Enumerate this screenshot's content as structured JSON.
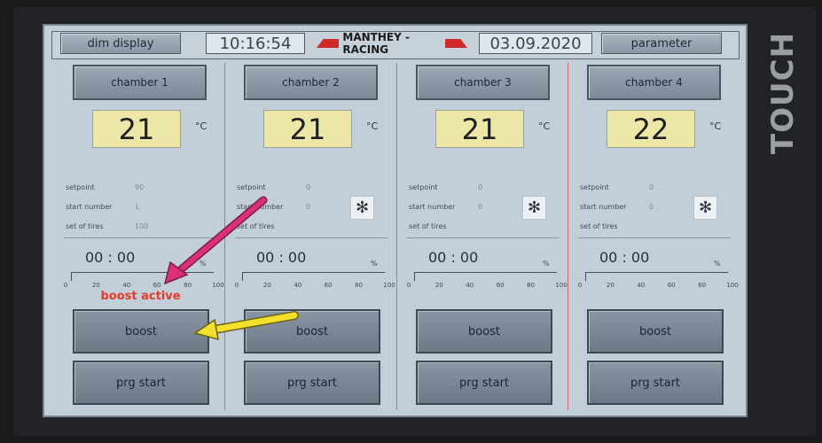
{
  "bezel": {
    "touch_label": "TOUCH"
  },
  "header": {
    "dim_label": "dim display",
    "time": "10:16:54",
    "logo": "MANTHEY - RACING",
    "date": "03.09.2020",
    "parameter_label": "parameter"
  },
  "labels": {
    "setpoint": "setpoint",
    "start_number": "start number",
    "set_of_tires": "set of tires",
    "unit": "°C",
    "percent": "%"
  },
  "ticks": [
    "0",
    "20",
    "40",
    "60",
    "80",
    "100"
  ],
  "chambers": [
    {
      "name": "chamber 1",
      "temp": "21",
      "setpoint": "90",
      "start_number": "1",
      "set_of_tires": "100",
      "time": "00 : 00",
      "status": "boost active",
      "boost": "boost",
      "prg": "prg start",
      "fan": false
    },
    {
      "name": "chamber 2",
      "temp": "21",
      "setpoint": "0",
      "start_number": "0",
      "set_of_tires": "",
      "time": "00 : 00",
      "status": "",
      "boost": "boost",
      "prg": "prg start",
      "fan": true
    },
    {
      "name": "chamber 3",
      "temp": "21",
      "setpoint": "0",
      "start_number": "0",
      "set_of_tires": "",
      "time": "00 : 00",
      "status": "",
      "boost": "boost",
      "prg": "prg start",
      "fan": true
    },
    {
      "name": "chamber 4",
      "temp": "22",
      "setpoint": "0",
      "start_number": "0",
      "set_of_tires": "",
      "time": "00 : 00",
      "status": "",
      "boost": "boost",
      "prg": "prg start",
      "fan": true
    }
  ],
  "colors": {
    "arrow_magenta": "#d9307a",
    "arrow_yellow": "#f2e02c",
    "status_red": "#e23b2b"
  },
  "icons": [
    "fan-icon",
    "arrow-annotation"
  ]
}
